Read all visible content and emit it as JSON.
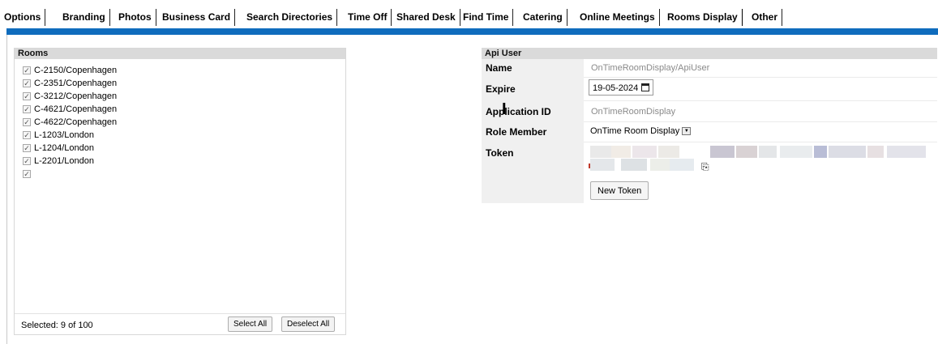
{
  "tabs": [
    "Options",
    "Branding",
    "Photos",
    "Business Card",
    "Search Directories",
    "Time Off",
    "Shared Desk",
    "Find Time",
    "Catering",
    "Online Meetings",
    "Rooms Display",
    "Other"
  ],
  "active_tab": "Rooms Display",
  "colors": {
    "accent_bar": "#0f6cbd",
    "header_bg": "#dadada",
    "label_bg": "#f0f0f0"
  },
  "rooms": {
    "title": "Rooms",
    "items": [
      "C-2150/Copenhagen",
      "C-2351/Copenhagen",
      "C-3212/Copenhagen",
      "C-4621/Copenhagen",
      "C-4622/Copenhagen",
      "L-1203/London",
      "L-1204/London",
      "L-2201/London",
      ""
    ],
    "selected_text": "Selected: 9 of 100",
    "select_all": "Select All",
    "deselect_all": "Deselect All"
  },
  "api_user": {
    "title": "Api User",
    "name_label": "Name",
    "name_value": "OnTimeRoomDisplay/ApiUser",
    "expire_label": "Expire",
    "expire_value": "19-05-2024",
    "appid_label": "Application ID",
    "appid_value": "OnTimeRoomDisplay",
    "role_label": "Role Member",
    "role_value": "OnTime Room Display",
    "token_label": "Token",
    "new_token": "New Token"
  }
}
